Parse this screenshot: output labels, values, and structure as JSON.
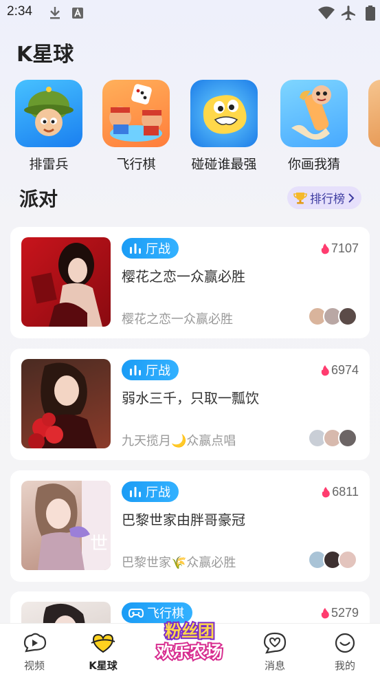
{
  "status": {
    "time": "2:34"
  },
  "page": {
    "title": "K星球"
  },
  "games": [
    {
      "name": "排雷兵",
      "icon": "minesweeper-soldier-icon"
    },
    {
      "name": "飞行棋",
      "icon": "ludo-dice-icon"
    },
    {
      "name": "碰碰谁最强",
      "icon": "bumper-blob-icon"
    },
    {
      "name": "你画我猜",
      "icon": "draw-guess-pencil-icon"
    }
  ],
  "party": {
    "title": "派对",
    "rank_label": "排行榜"
  },
  "rooms": [
    {
      "tag": "厅战",
      "heat": "7107",
      "title": "樱花之恋一众赢必胜",
      "subtitle": "樱花之恋一众赢必胜"
    },
    {
      "tag": "厅战",
      "heat": "6974",
      "title": "弱水三千，只取一瓢饮",
      "subtitle": "九天揽月🌙众赢点唱"
    },
    {
      "tag": "厅战",
      "heat": "6811",
      "title": "巴黎世家由胖哥豪冠",
      "subtitle": "巴黎世家🌾众赢必胜"
    },
    {
      "tag": "飞行棋",
      "heat": "5279",
      "title": "",
      "subtitle": ""
    }
  ],
  "nav": [
    {
      "label": "视频",
      "icon": "video-icon"
    },
    {
      "label": "K星球",
      "icon": "heart-planet-icon",
      "active": true
    },
    {
      "label": "消息",
      "icon": "message-icon"
    },
    {
      "label": "我的",
      "icon": "profile-icon"
    }
  ],
  "promo": {
    "text": "粉丝团欢乐农场"
  },
  "colors": {
    "accent": "#1b9cf5",
    "heat": "#ff3c6f",
    "rank_bg": "#e6e0fb"
  }
}
